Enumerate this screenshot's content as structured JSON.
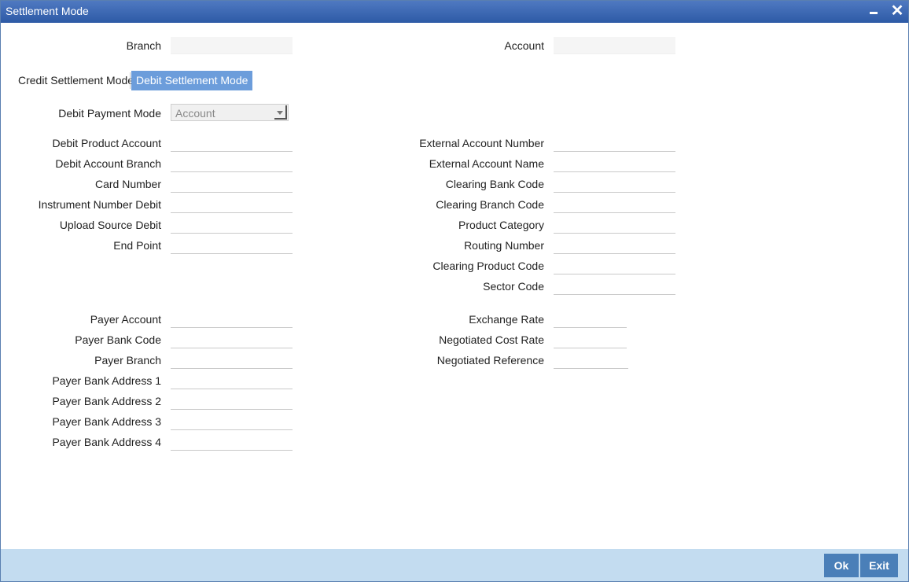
{
  "window": {
    "title": "Settlement Mode"
  },
  "header": {
    "branch_label": "Branch",
    "branch_value": "",
    "account_label": "Account",
    "account_value": ""
  },
  "tabs": {
    "credit": "Credit Settlement Mode",
    "debit": "Debit Settlement Mode",
    "active": "debit"
  },
  "payment_mode": {
    "label": "Debit Payment Mode",
    "value": "Account"
  },
  "left_fields": [
    {
      "label": "Debit Product Account",
      "value": ""
    },
    {
      "label": "Debit Account Branch",
      "value": ""
    },
    {
      "label": "Card Number",
      "value": ""
    },
    {
      "label": "Instrument Number Debit",
      "value": ""
    },
    {
      "label": "Upload Source Debit",
      "value": ""
    },
    {
      "label": "End Point",
      "value": ""
    }
  ],
  "right_fields": [
    {
      "label": "External Account Number",
      "value": ""
    },
    {
      "label": "External Account Name",
      "value": ""
    },
    {
      "label": "Clearing Bank Code",
      "value": ""
    },
    {
      "label": "Clearing Branch Code",
      "value": ""
    },
    {
      "label": "Product Category",
      "value": ""
    },
    {
      "label": "Routing Number",
      "value": ""
    },
    {
      "label": "Clearing Product Code",
      "value": ""
    },
    {
      "label": "Sector Code",
      "value": ""
    }
  ],
  "payer_fields": [
    {
      "label": "Payer Account",
      "value": ""
    },
    {
      "label": "Payer Bank Code",
      "value": ""
    },
    {
      "label": "Payer Branch",
      "value": ""
    },
    {
      "label": "Payer Bank Address 1",
      "value": ""
    },
    {
      "label": "Payer Bank Address 2",
      "value": ""
    },
    {
      "label": "Payer Bank Address 3",
      "value": ""
    },
    {
      "label": "Payer Bank Address 4",
      "value": ""
    }
  ],
  "rate_fields": [
    {
      "label": "Exchange Rate",
      "value": ""
    },
    {
      "label": "Negotiated Cost Rate",
      "value": ""
    },
    {
      "label": "Negotiated Reference",
      "value": ""
    }
  ],
  "footer": {
    "ok": "Ok",
    "exit": "Exit"
  },
  "colors": {
    "titlebar": "#3a67b3",
    "active_tab": "#6c9ddb",
    "footer": "#c3dcf0",
    "button": "#4a7fb8"
  },
  "icons": {
    "minimize": "minimize-icon",
    "close": "close-icon",
    "dropdown": "chevron-down-icon"
  }
}
